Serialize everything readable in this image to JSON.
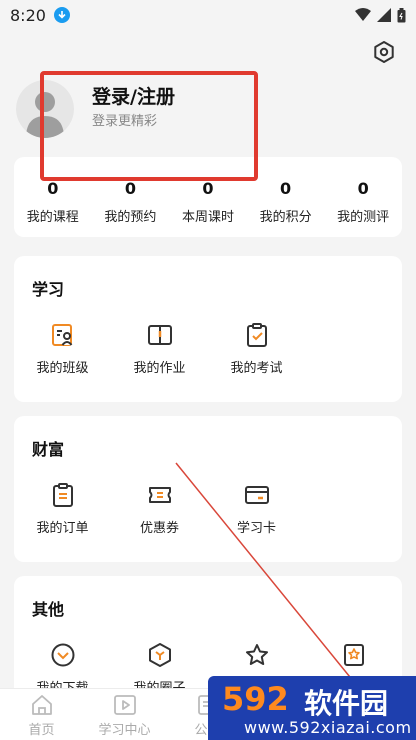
{
  "status_bar": {
    "time": "8:20"
  },
  "profile": {
    "title": "登录/注册",
    "subtitle": "登录更精彩"
  },
  "stats": [
    {
      "value": "0",
      "label": "我的课程"
    },
    {
      "value": "0",
      "label": "我的预约"
    },
    {
      "value": "0",
      "label": "本周课时"
    },
    {
      "value": "0",
      "label": "我的积分"
    },
    {
      "value": "0",
      "label": "我的测评"
    }
  ],
  "sections": {
    "study": {
      "title": "学习",
      "items": [
        {
          "label": "我的班级",
          "icon": "class-icon"
        },
        {
          "label": "我的作业",
          "icon": "homework-icon"
        },
        {
          "label": "我的考试",
          "icon": "exam-icon"
        }
      ]
    },
    "wealth": {
      "title": "财富",
      "items": [
        {
          "label": "我的订单",
          "icon": "order-icon"
        },
        {
          "label": "优惠券",
          "icon": "coupon-icon"
        },
        {
          "label": "学习卡",
          "icon": "card-icon"
        }
      ]
    },
    "other": {
      "title": "其他",
      "items": [
        {
          "label": "我的下载",
          "icon": "download-icon"
        },
        {
          "label": "我的圈子",
          "icon": "circle-icon"
        },
        {
          "label": "",
          "icon": "star-icon"
        },
        {
          "label": "",
          "icon": "badge-icon"
        }
      ]
    }
  },
  "bottom_nav": [
    {
      "label": "首页",
      "icon": "home-icon"
    },
    {
      "label": "学习中心",
      "icon": "play-icon"
    },
    {
      "label": "公告",
      "icon": "notice-icon"
    }
  ],
  "watermark": {
    "number": "592",
    "brand": "软件园",
    "url": "www.592xiazai.com"
  },
  "colors": {
    "accent": "#f08a24",
    "highlight": "#e03a2f",
    "background": "#f4f4f4"
  }
}
